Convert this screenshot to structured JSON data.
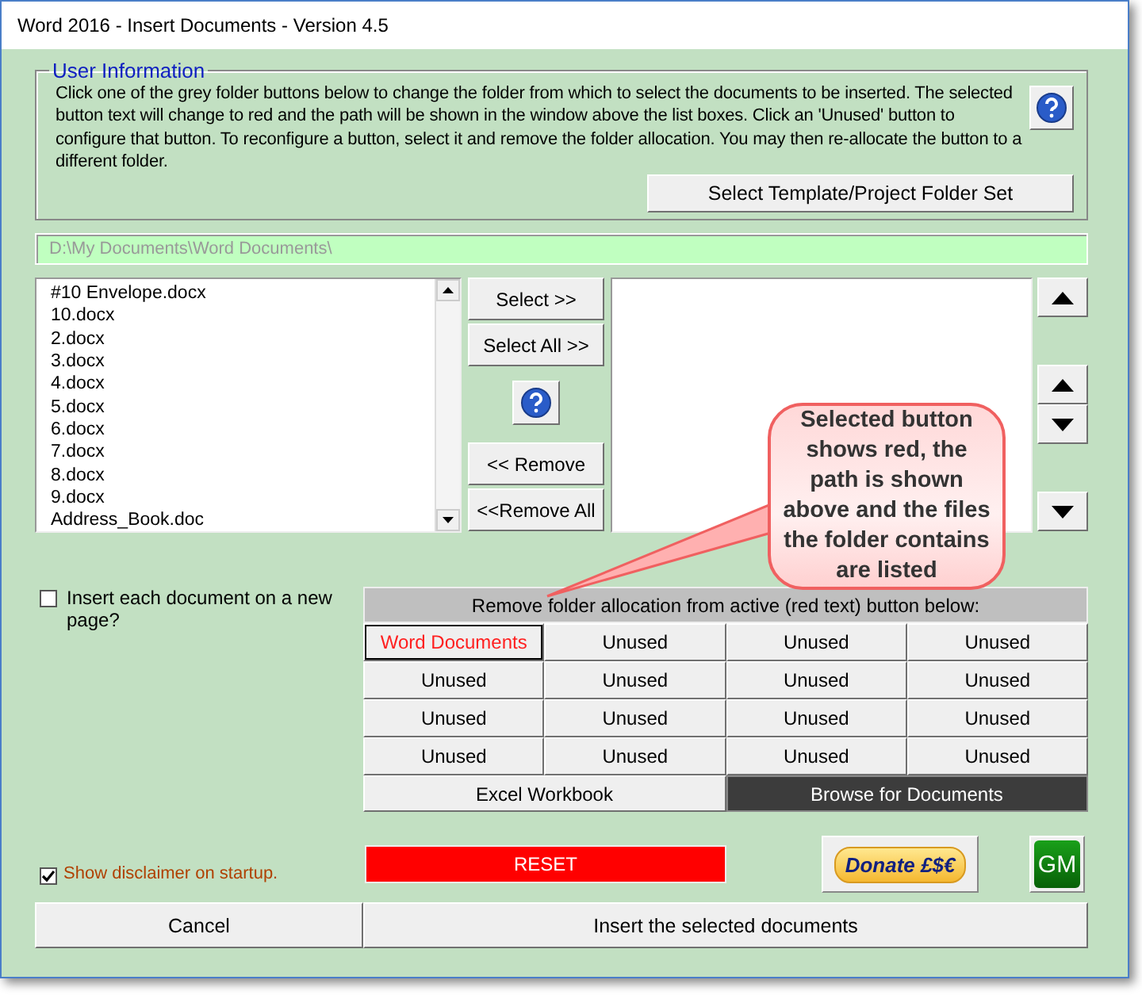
{
  "window": {
    "title": "Word 2016 - Insert Documents - Version 4.5"
  },
  "user_information": {
    "legend": "User Information",
    "text": "Click one of the grey folder buttons below to change the folder from which to select the documents to be inserted. The selected button text will change to red and the path will be shown in the window above the list boxes. Click an 'Unused' button to configure that button. To reconfigure a button, select it and remove the folder allocation. You may then re-allocate the button to a different folder.",
    "folder_set_button": "Select Template/Project Folder Set"
  },
  "path_field": {
    "value": "D:\\My Documents\\Word Documents\\"
  },
  "file_list": {
    "items": [
      "#10 Envelope.docx",
      "10.docx",
      "2.docx",
      "3.docx",
      "4.docx",
      "5.docx",
      "6.docx",
      "7.docx",
      "8.docx",
      "9.docx",
      "Address_Book.doc"
    ]
  },
  "transfer_buttons": [
    {
      "label": "Select >>",
      "kind": "button"
    },
    {
      "label": "Select All >>",
      "kind": "button"
    },
    {
      "kind": "help"
    },
    {
      "label": "<< Remove",
      "kind": "button"
    },
    {
      "label": "<<Remove All",
      "kind": "button"
    }
  ],
  "insert_on_new_page": {
    "label": "Insert each document on a new page?",
    "checked": false
  },
  "folder_panel": {
    "header": "Remove folder allocation from active (red text) button below:",
    "buttons": [
      {
        "label": "Word Documents",
        "selected": true
      },
      {
        "label": "Unused",
        "selected": false
      },
      {
        "label": "Unused",
        "selected": false
      },
      {
        "label": "Unused",
        "selected": false
      },
      {
        "label": "Unused",
        "selected": false
      },
      {
        "label": "Unused",
        "selected": false
      },
      {
        "label": "Unused",
        "selected": false
      },
      {
        "label": "Unused",
        "selected": false
      },
      {
        "label": "Unused",
        "selected": false
      },
      {
        "label": "Unused",
        "selected": false
      },
      {
        "label": "Unused",
        "selected": false
      },
      {
        "label": "Unused",
        "selected": false
      },
      {
        "label": "Unused",
        "selected": false
      },
      {
        "label": "Unused",
        "selected": false
      },
      {
        "label": "Unused",
        "selected": false
      },
      {
        "label": "Unused",
        "selected": false
      }
    ],
    "excel_button": "Excel Workbook",
    "browse_button": "Browse for Documents"
  },
  "callout": {
    "text": "Selected button shows red, the path is shown above and the files the folder contains are listed"
  },
  "show_disclaimer": {
    "label": "Show disclaimer on startup.",
    "checked": true
  },
  "reset_button": "RESET",
  "donate_button": "Donate £$€",
  "gm_button": "GM",
  "cancel_button": "Cancel",
  "insert_button": "Insert the selected documents"
}
